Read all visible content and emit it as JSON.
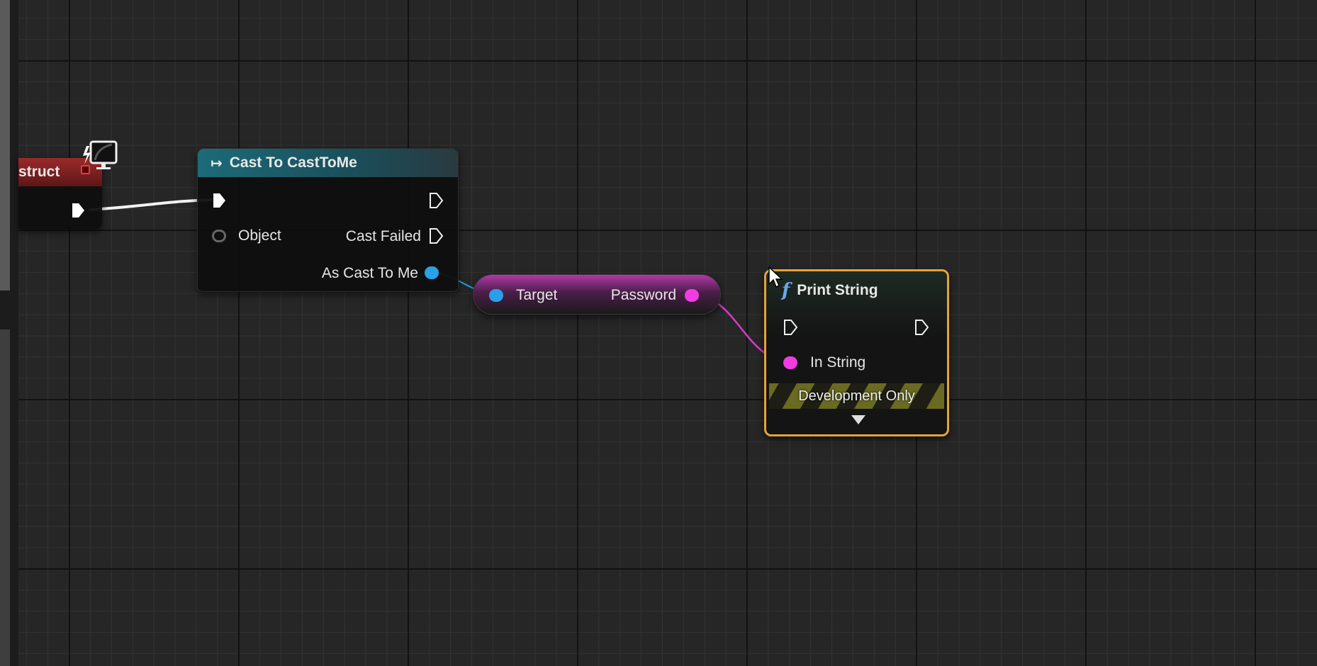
{
  "construct_node": {
    "title": "struct",
    "icon": "monitor-event-icon",
    "color": "#8a2020"
  },
  "cast_node": {
    "title": "Cast To CastToMe",
    "icon": "cast-arrow-icon",
    "object_pin": "Object",
    "cast_failed_pin": "Cast Failed",
    "as_pin": "As Cast To Me",
    "color": "#1e5a66"
  },
  "get_node": {
    "target_pin": "Target",
    "output_pin": "Password",
    "color": "#d23ac8"
  },
  "print_node": {
    "title": "Print String",
    "icon": "function-icon",
    "in_string_pin": "In String",
    "dev_only": "Development Only",
    "expand_icon": "triangle-down-icon",
    "selection_color": "#e6a23a"
  },
  "colors": {
    "exec": "#ffffff",
    "object": "#2aa0e8",
    "string": "#f03ce0"
  }
}
